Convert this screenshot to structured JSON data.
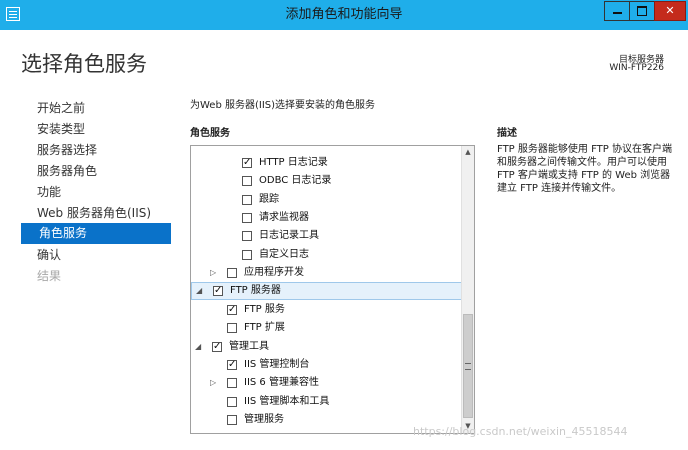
{
  "window": {
    "title": "添加角色和功能向导",
    "controls": {
      "minimize": "minimize",
      "maximize": "maximize",
      "close": "✕"
    }
  },
  "page": {
    "title": "选择角色服务",
    "destination_label": "目标服务器",
    "destination_value": "WIN-FTP226"
  },
  "nav": {
    "items": [
      {
        "label": "开始之前",
        "state": "normal"
      },
      {
        "label": "安装类型",
        "state": "normal"
      },
      {
        "label": "服务器选择",
        "state": "normal"
      },
      {
        "label": "服务器角色",
        "state": "normal"
      },
      {
        "label": "功能",
        "state": "normal"
      },
      {
        "label": "Web 服务器角色(IIS)",
        "state": "normal"
      },
      {
        "label": "角色服务",
        "state": "selected"
      },
      {
        "label": "确认",
        "state": "normal"
      },
      {
        "label": "结果",
        "state": "disabled"
      }
    ]
  },
  "main": {
    "intro": "为Web 服务器(IIS)选择要安装的角色服务",
    "role_services_header": "角色服务",
    "tree": [
      {
        "label": "HTTP 日志记录",
        "checked": true,
        "level": 3,
        "expander": ""
      },
      {
        "label": "ODBC 日志记录",
        "checked": false,
        "level": 3,
        "expander": ""
      },
      {
        "label": "跟踪",
        "checked": false,
        "level": 3,
        "expander": ""
      },
      {
        "label": "请求监视器",
        "checked": false,
        "level": 3,
        "expander": ""
      },
      {
        "label": "日志记录工具",
        "checked": false,
        "level": 3,
        "expander": ""
      },
      {
        "label": "自定义日志",
        "checked": false,
        "level": 3,
        "expander": ""
      },
      {
        "label": "应用程序开发",
        "checked": false,
        "level": 2,
        "expander": "▷"
      },
      {
        "label": "FTP 服务器",
        "checked": true,
        "level": 1,
        "expander": "◢",
        "selected": true
      },
      {
        "label": "FTP 服务",
        "checked": true,
        "level": 2,
        "expander": ""
      },
      {
        "label": "FTP 扩展",
        "checked": false,
        "level": 2,
        "expander": ""
      },
      {
        "label": "管理工具",
        "checked": true,
        "level": 1,
        "expander": "◢"
      },
      {
        "label": "IIS 管理控制台",
        "checked": true,
        "level": 2,
        "expander": ""
      },
      {
        "label": "IIS 6 管理兼容性",
        "checked": false,
        "level": 2,
        "expander": "▷"
      },
      {
        "label": "IIS 管理脚本和工具",
        "checked": false,
        "level": 2,
        "expander": ""
      },
      {
        "label": "管理服务",
        "checked": false,
        "level": 2,
        "expander": ""
      }
    ]
  },
  "description": {
    "header": "描述",
    "text": "FTP 服务器能够使用 FTP 协议在客户端和服务器之间传输文件。用户可以使用 FTP 客户端或支持 FTP 的 Web 浏览器建立 FTP 连接并传输文件。"
  },
  "watermark": "https://blog.csdn.net/weixin_45518544"
}
